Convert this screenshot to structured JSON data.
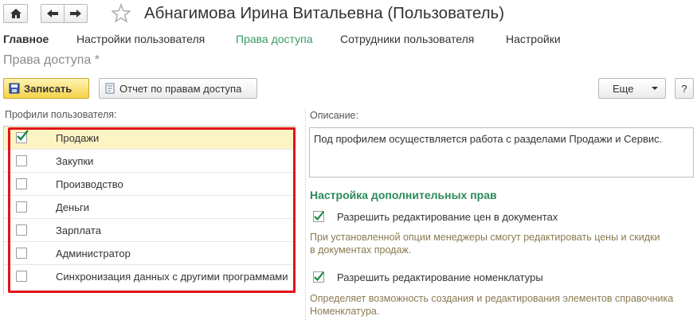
{
  "window": {
    "title": "Абнагимова Ирина Витальевна (Пользователь)",
    "subtitle": "Права доступа *"
  },
  "tabs": [
    {
      "label": "Главное"
    },
    {
      "label": "Настройки пользователя"
    },
    {
      "label": "Права доступа"
    },
    {
      "label": "Сотрудники пользователя"
    },
    {
      "label": "Настройки"
    }
  ],
  "toolbar": {
    "save_label": "Записать",
    "report_label": "Отчет по правам доступа",
    "more_label": "Еще",
    "help_label": "?"
  },
  "profiles": {
    "label": "Профили пользователя:",
    "items": [
      {
        "label": "Продажи",
        "checked": true
      },
      {
        "label": "Закупки",
        "checked": false
      },
      {
        "label": "Производство",
        "checked": false
      },
      {
        "label": "Деньги",
        "checked": false
      },
      {
        "label": "Зарплата",
        "checked": false
      },
      {
        "label": "Администратор",
        "checked": false
      },
      {
        "label": "Синхронизация данных с другими программами",
        "checked": false
      }
    ]
  },
  "description": {
    "label": "Описание:",
    "text": "Под профилем осуществляется работа с разделами Продажи и Сервис."
  },
  "extra_rights": {
    "title": "Настройка дополнительных прав",
    "options": [
      {
        "label": "Разрешить редактирование цен в документах",
        "checked": true,
        "hint_line1": "При установленной опции менеджеры смогут редактировать цены и скидки",
        "hint_line2": "в документах продаж."
      },
      {
        "label": "Разрешить редактирование номенклатуры",
        "checked": true,
        "hint_line1": "Определяет возможность создания и редактирования элементов справочника",
        "hint_line2": "Номенклатура."
      }
    ]
  },
  "colors": {
    "accent_green": "#3a9a66",
    "highlight_red": "#e0131a",
    "selected_row": "#fdf4c4",
    "save_button": "#f5d24a"
  }
}
